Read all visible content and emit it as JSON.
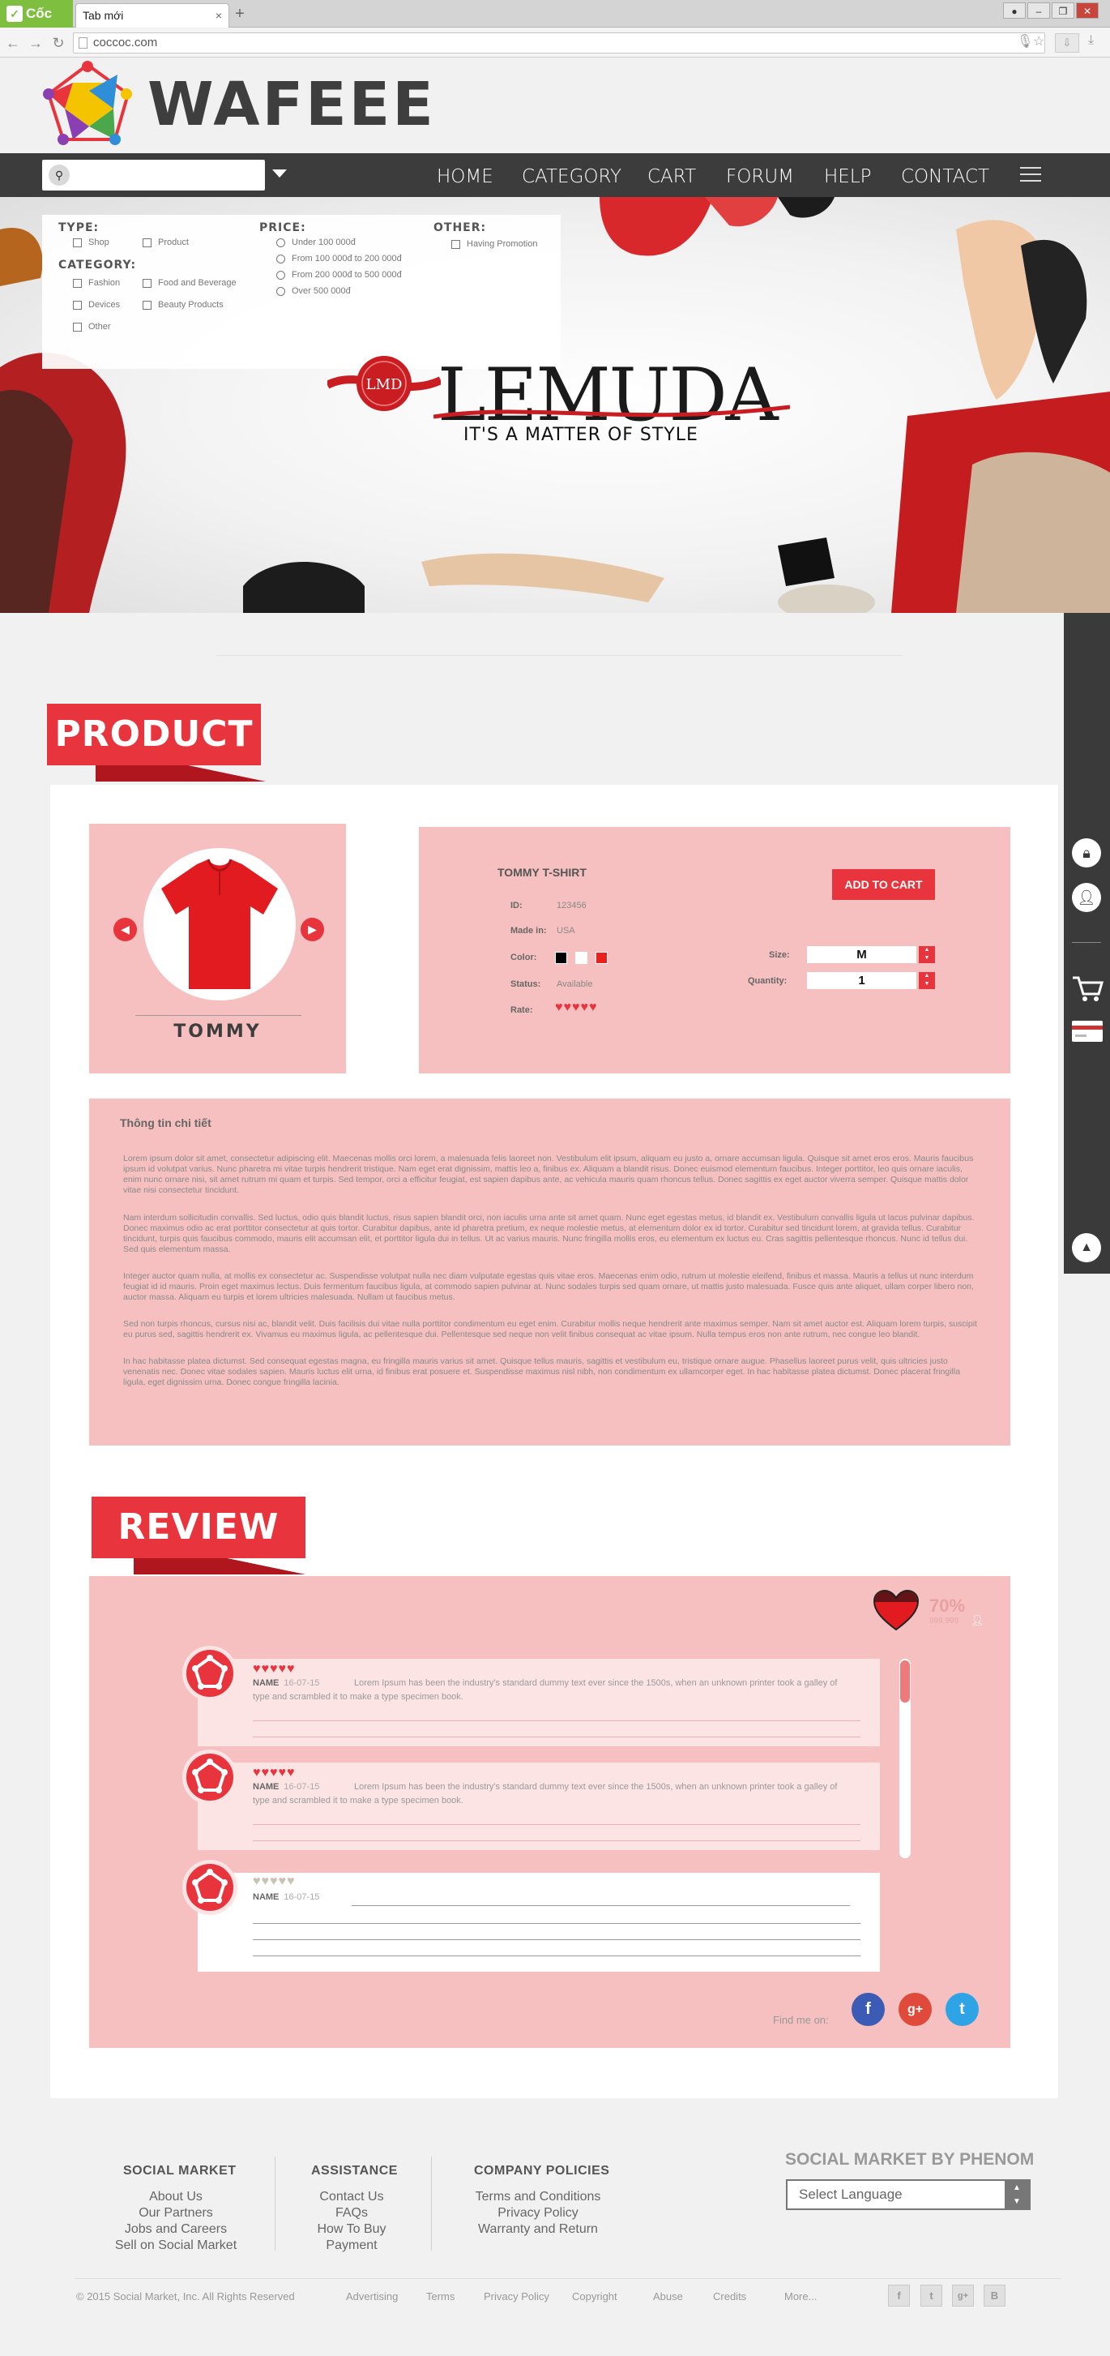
{
  "browser": {
    "brand": "Cốc Cốc",
    "tab_title": "Tab mới",
    "tab_close": "×",
    "new_tab": "+",
    "address": "coccoc.com"
  },
  "header": {
    "brand": "WAFEEE",
    "search_placeholder": "",
    "nav": [
      "HOME",
      "CATEGORY",
      "CART",
      "FORUM",
      "HELP",
      "CONTACT"
    ]
  },
  "filters": {
    "type_label": "TYPE:",
    "type_options": [
      "Shop",
      "Product"
    ],
    "category_label": "CATEGORY:",
    "category_options": [
      "Fashion",
      "Food and Beverage",
      "Devices",
      "Beauty Products",
      "Other"
    ],
    "price_label": "PRICE:",
    "price_options": [
      "Under 100 000đ",
      "From 100 000đ to 200 000đ",
      "From 200 000đ to 500 000đ",
      "Over 500 000đ"
    ],
    "other_label": "OTHER:",
    "other_options": [
      "Having Promotion"
    ]
  },
  "hero": {
    "mark": "LMD",
    "title": "LEMUDA",
    "tagline": "IT'S A MATTER OF STYLE"
  },
  "product_section": {
    "ribbon": "PRODUCT",
    "gallery_name": "TOMMY",
    "name": "TOMMY T-SHIRT",
    "add_to_cart": "ADD TO CART",
    "fields": {
      "id_label": "ID:",
      "id": "123456",
      "made_label": "Made in:",
      "made": "USA",
      "color_label": "Color:",
      "status_label": "Status:",
      "status": "Available",
      "rate_label": "Rate:"
    },
    "colors": [
      "#000000",
      "#ffffff",
      "#e8211d"
    ],
    "rating": 5,
    "size_label": "Size:",
    "size": "M",
    "quantity_label": "Quantity:",
    "quantity": "1"
  },
  "description": {
    "title": "Thông tin chi tiết",
    "paragraphs": [
      "Lorem ipsum dolor sit amet, consectetur adipiscing elit. Maecenas mollis orci lorem, a malesuada felis laoreet non. Vestibulum elit ipsum, aliquam eu justo a, ornare accumsan ligula. Quisque sit amet eros eros. Mauris faucibus ipsum id volutpat varius. Nunc pharetra mi vitae turpis hendrerit tristique. Nam eget erat dignissim, mattis leo a, finibus ex. Aliquam a blandit risus. Donec euismod elementum faucibus. Integer porttitor, leo quis ornare iaculis, enim nunc ornare nisi, sit amet rutrum mi quam et turpis. Sed tempor, orci a efficitur feugiat, est sapien dapibus ante, ac vehicula mauris quam rhoncus tellus. Donec sagittis ex eget auctor viverra semper. Quisque mattis dolor vitae nisi consectetur tincidunt.",
      "Nam interdum sollicitudin convallis. Sed luctus, odio quis blandit luctus, risus sapien blandit orci, non iaculis urna ante sit amet quam. Nunc eget egestas metus, id blandit ex. Vestibulum convallis ligula ut lacus pulvinar dapibus. Donec maximus odio ac erat porttitor consectetur at quis tortor. Curabitur dapibus, ante id pharetra pretium, ex neque molestie metus, at elementum dolor ex id tortor. Curabitur sed tincidunt lorem, at gravida tellus. Curabitur tincidunt, turpis quis faucibus commodo, mauris elit accumsan elit, et porttitor ligula dui in tellus. Ut ac varius mauris. Nunc fringilla mollis eros, eu elementum ex luctus eu. Cras sagittis pellentesque rhoncus. Nunc id tellus dui. Sed quis elementum massa.",
      "Integer auctor quam nulla, at mollis ex consectetur ac. Suspendisse volutpat nulla nec diam vulputate egestas quis vitae eros. Maecenas enim odio, rutrum ut molestie eleifend, finibus et massa. Mauris a tellus ut nunc interdum feugiat id id mauris. Proin eget maximus lectus. Duis fermentum faucibus ligula, at commodo sapien pulvinar at. Nunc sodales turpis sed quam ornare, ut mattis justo malesuada. Fusce quis ante aliquet, ullam corper libero non, auctor massa. Aliquam eu turpis et lorem ultricies malesuada. Nullam ut faucibus metus.",
      "Sed non turpis rhoncus, cursus nisi ac, blandit velit. Duis facilisis dui vitae nulla porttitor condimentum eu eget enim. Curabitur mollis neque hendrerit ante maximus semper. Nam sit amet auctor est. Aliquam lorem turpis, suscipit eu purus sed, sagittis hendrerit ex. Vivamus eu maximus ligula, ac pellentesque dui. Pellentesque sed neque non velit finibus consequat ac vitae ipsum. Nulla tempus eros non ante rutrum, nec congue leo blandit.",
      "In hac habitasse platea dictumst. Sed consequat egestas magna, eu fringilla mauris varius sit amet. Quisque tellus mauris, sagittis et vestibulum eu, tristique ornare augue. Phasellus laoreet purus velit, quis ultricies justo venenatis nec. Donec vitae sodales sapien. Mauris luctus elit urna, id finibus erat posuere et. Suspendisse maximus nisl nibh, non condimentum ex ullamcorper eget. In hac habitasse platea dictumst. Donec placerat fringilla ligula, eget dignissim urna. Donec congue fringilla lacinia."
    ]
  },
  "reviews": {
    "ribbon": "REVIEW",
    "percent": "70%",
    "count": "999,999",
    "items": [
      {
        "name": "NAME",
        "date": "16-07-15",
        "rating": 5,
        "text": "Lorem Ipsum has been the industry's standard dummy text ever since the 1500s, when an unknown printer took a galley of type and scrambled it to make a type specimen book."
      },
      {
        "name": "NAME",
        "date": "16-07-15",
        "rating": 5,
        "text": "Lorem Ipsum has been the industry's standard dummy text ever since the 1500s, when an unknown printer took a galley of type and scrambled it to make a type specimen book."
      },
      {
        "name": "NAME",
        "date": "16-07-15",
        "rating": 0,
        "text": ""
      }
    ],
    "find_me": "Find me on:",
    "social": [
      "f",
      "g+",
      "t"
    ]
  },
  "footer": {
    "cols": [
      {
        "title": "SOCIAL MARKET",
        "links": [
          "About Us",
          "Our Partners",
          "Jobs and Careers",
          "Sell on Social Market"
        ]
      },
      {
        "title": "ASSISTANCE",
        "links": [
          "Contact Us",
          "FAQs",
          "How To Buy",
          "Payment"
        ]
      },
      {
        "title": "COMPANY POLICIES",
        "links": [
          "Terms and Conditions",
          "Privacy Policy",
          "Warranty and Return"
        ]
      }
    ],
    "brand": "SOCIAL MARKET BY PHENOM",
    "language": "Select Language",
    "copyright": "© 2015 Social Market, Inc. All Rights Reserved",
    "bottom_links": [
      "Advertising",
      "Terms",
      "Privacy Policy",
      "Copyright",
      "Abuse",
      "Credits",
      "More..."
    ],
    "social": [
      "f",
      "t",
      "g+",
      "B"
    ]
  }
}
